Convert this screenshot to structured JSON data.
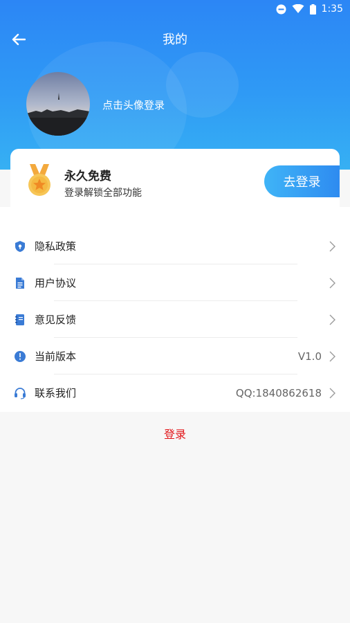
{
  "status_bar": {
    "time": "1:35",
    "icons": [
      "dnd-icon",
      "wifi-icon",
      "battery-icon"
    ]
  },
  "nav": {
    "title": "我的",
    "back_icon": "arrow-left-icon"
  },
  "profile": {
    "login_hint": "点击头像登录"
  },
  "member": {
    "title": "永久免费",
    "subtitle": "登录解锁全部功能",
    "login_button": "去登录",
    "icon": "medal-icon"
  },
  "menu": {
    "items": [
      {
        "label": "隐私政策",
        "value": "",
        "icon": "shield-icon"
      },
      {
        "label": "用户协议",
        "value": "",
        "icon": "document-icon"
      },
      {
        "label": "意见反馈",
        "value": "",
        "icon": "notebook-icon"
      },
      {
        "label": "当前版本",
        "value": "V1.0",
        "icon": "info-icon"
      },
      {
        "label": "联系我们",
        "value": "QQ:1840862618",
        "icon": "headset-icon"
      }
    ]
  },
  "footer": {
    "login_link": "登录"
  },
  "colors": {
    "header_top": "#2c86f5",
    "header_bottom": "#36b0f3",
    "accent": "#2e8bf0",
    "icon_blue": "#3a7bd5",
    "logout_red": "#e2161a",
    "medal_gold": "#f5b942"
  }
}
